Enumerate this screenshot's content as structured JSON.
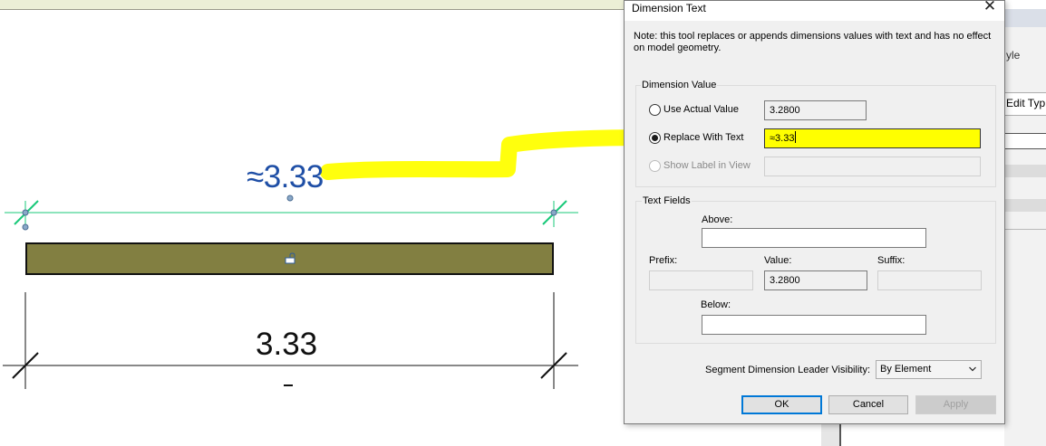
{
  "canvas": {
    "top_dimension_text": "≈3.33",
    "bottom_dimension_text": "3.33",
    "highlight_color": "#ffff00",
    "beam_color": "#827f41",
    "dimension_line_color": "#19c97a"
  },
  "properties_panel": {
    "partial_label": "yle",
    "edit_type_label": "Edit Typ"
  },
  "dialog": {
    "title": "Dimension Text",
    "close_symbol": "✕",
    "note": "Note: this tool replaces or appends dimensions values with text and has no effect on model geometry.",
    "dimension_value": {
      "group_label": "Dimension Value",
      "use_actual_label": "Use Actual Value",
      "use_actual_value": "3.2800",
      "replace_label": "Replace With Text",
      "replace_value": "≈3.33",
      "show_label": "Show Label in View",
      "show_label_value": "",
      "selected": "replace"
    },
    "text_fields": {
      "group_label": "Text Fields",
      "above_label": "Above:",
      "above_value": "",
      "prefix_label": "Prefix:",
      "prefix_value": "",
      "value_label": "Value:",
      "value_value": "3.2800",
      "suffix_label": "Suffix:",
      "suffix_value": "",
      "below_label": "Below:",
      "below_value": ""
    },
    "leader_visibility": {
      "label": "Segment Dimension Leader Visibility:",
      "selected": "By Element"
    },
    "buttons": {
      "ok": "OK",
      "cancel": "Cancel",
      "apply": "Apply"
    }
  }
}
